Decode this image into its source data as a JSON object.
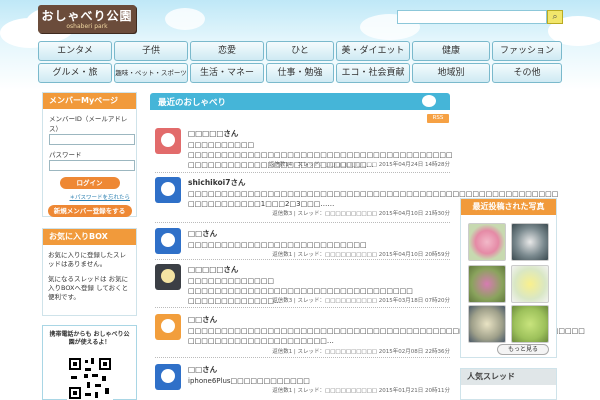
{
  "header": {
    "logo_title": "おしゃべり公園",
    "logo_sub": "oshaberi park",
    "search_placeholder": ""
  },
  "nav": {
    "row1": [
      "エンタメ",
      "子供",
      "恋愛",
      "ひと",
      "美・ダイエット",
      "健康",
      "ファッション"
    ],
    "row2": [
      "グルメ・旅",
      "趣味・ペット・スポーツ",
      "生活・マネー",
      "仕事・勉強",
      "エコ・社会貢献",
      "地域別",
      "その他"
    ]
  },
  "member": {
    "title": "メンバーMyページ",
    "id_label": "メンバーID（メールアドレス）",
    "pw_label": "パスワード",
    "login": "ログイン",
    "forgot": "＊パスワードを忘れたら",
    "register": "新規メンバー登録をする"
  },
  "favorites": {
    "title": "お気に入りBOX",
    "text1": "お気に入りに登録したスレッドはありません。",
    "text2": "気になるスレッドは お気に入りBOXへ登録 しておくと便利です。"
  },
  "mobile": {
    "text": "携帯電話からも おしゃべり公園が使えるよ！"
  },
  "main": {
    "title": "最近のおしゃべり",
    "rss": "RSS",
    "posts": [
      {
        "name": "□□□□□さん",
        "body": "□□□□□□□□□□ □□□□□□□□□□□□□□□□□□□□□□□□□□□□□□□□□□□□□□□□ □□□□□□□□□□□□□□□□□□□□□□□□□□□…",
        "meta": "返信数14 | スレッド：□□□□□□□□□□ 2015年04月24日 14時28分"
      },
      {
        "name": "shichikoi7さん",
        "body": "□□□□□□□□□□□□□□□□□□□□□□□□□□□□□□□□□□□□□□□□□□□□□□□□□□□□□□□□ □□□□□□□□□□□1□□□2□3□□□……",
        "meta": "返信数3 | スレッド：□□□□□□□□□□ 2015年04月10日 21時30分"
      },
      {
        "name": "□□さん",
        "body": "□□□□□□□□□□□□□□□□□□□□□□□□□□□",
        "meta": "返信数1 | スレッド：□□□□□□□□□□ 2015年04月10日 20時59分"
      },
      {
        "name": "□□□□□さん",
        "body": "□□□□□□□□□□□□□ □□□□□□□□□□□□□□□□□□□□□□□□□□□□□□□□□□ □□□□□□□□□□□□□…",
        "meta": "返信数3 | スレッド：□□□□□□□□□□ 2015年03月18日 07時20分"
      },
      {
        "name": "□□さん",
        "body": "□□□□□□□□□□□□□□□□□□□□□□□□□□□□□□□□□□□□□□□□□□□□□□□□□□□□□□□□□□□□ □□□□□□□□□□□□□□□□□□□□□…",
        "meta": "返信数1 | スレッド：□□□□□□□□□□ 2015年02月08日 22時36分"
      },
      {
        "name": "□□さん",
        "body": "iphone6Plus□□□□□□□□□□□□",
        "meta": "返信数1 | スレッド：□□□□□□□□□□ 2015年01月21日 20時11分"
      }
    ]
  },
  "photos": {
    "title": "最近投稿された写真",
    "more": "もっと見る"
  },
  "popular": {
    "title": "人気スレッド"
  },
  "colors": {
    "accent_orange": "#f19a3b",
    "accent_blue": "#45b5d8",
    "logo_brown": "#6b4c3b"
  }
}
